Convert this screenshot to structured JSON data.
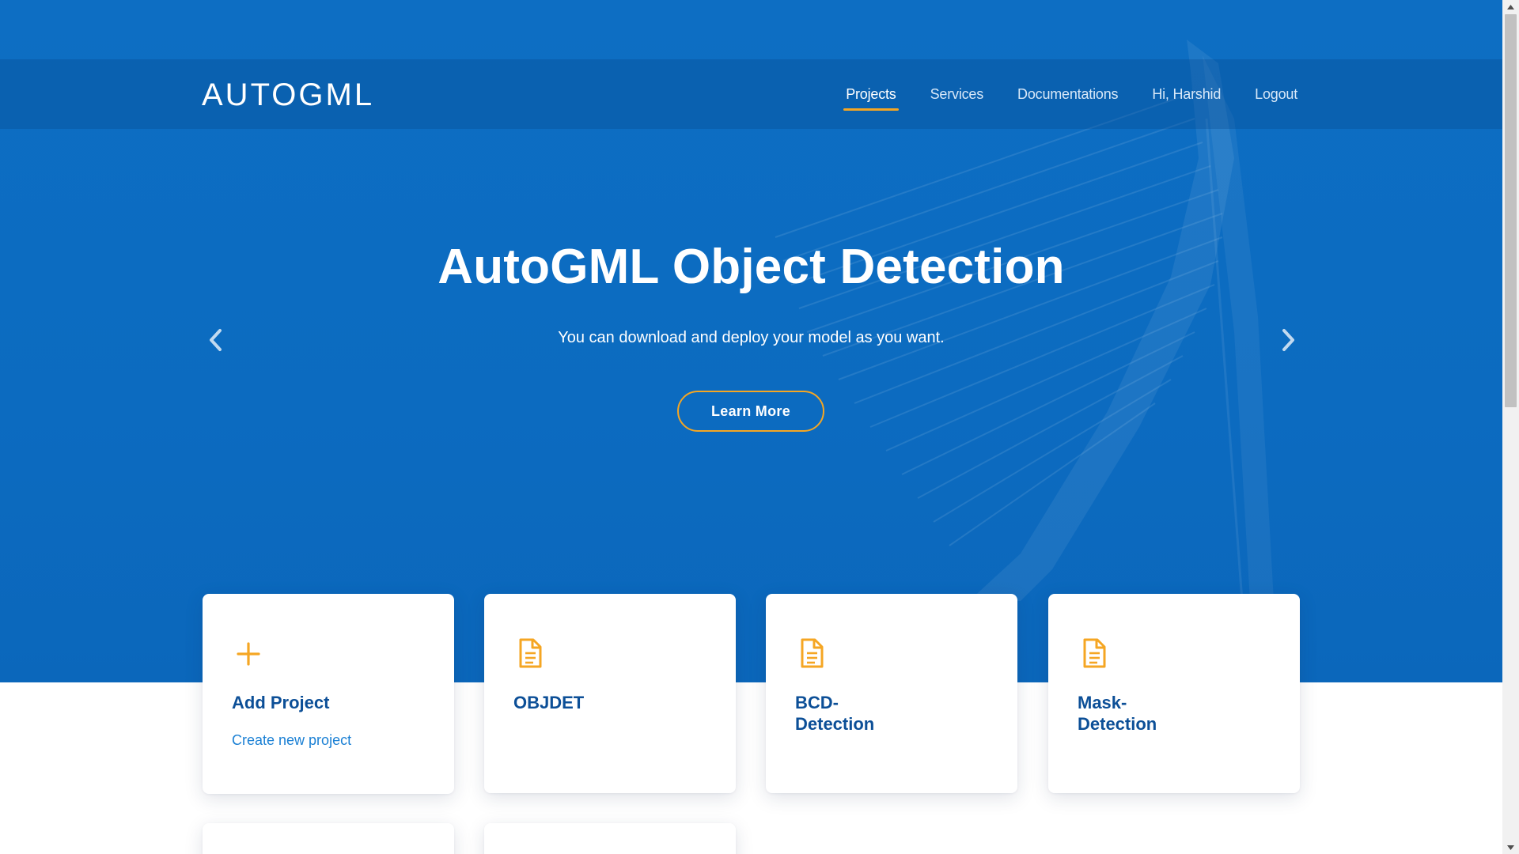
{
  "navbar": {
    "brand": "AUTOGML",
    "links": [
      {
        "label": "Projects",
        "active": true
      },
      {
        "label": "Services",
        "active": false
      },
      {
        "label": "Documentations",
        "active": false
      },
      {
        "label": "Hi, Harshid",
        "active": false
      },
      {
        "label": "Logout",
        "active": false
      }
    ]
  },
  "hero": {
    "title": "AutoGML Object Detection",
    "subtitle": "You can download and deploy your model as you want.",
    "cta_label": "Learn More",
    "prev_icon": "chevron-left-icon",
    "next_icon": "chevron-right-icon"
  },
  "projects": {
    "add_card": {
      "title": "Add Project",
      "subtitle": "Create new project",
      "icon": "plus-icon"
    },
    "items": [
      {
        "title": "OBJDET",
        "icon": "document-icon"
      },
      {
        "title": "BCD-\nDetection",
        "icon": "document-icon"
      },
      {
        "title": "Mask-\nDetection",
        "icon": "document-icon"
      }
    ]
  },
  "colors": {
    "hero_blue": "#0c6bc0",
    "accent": "#f5a623",
    "card_title": "#0c4f97",
    "link": "#1b80d4"
  }
}
